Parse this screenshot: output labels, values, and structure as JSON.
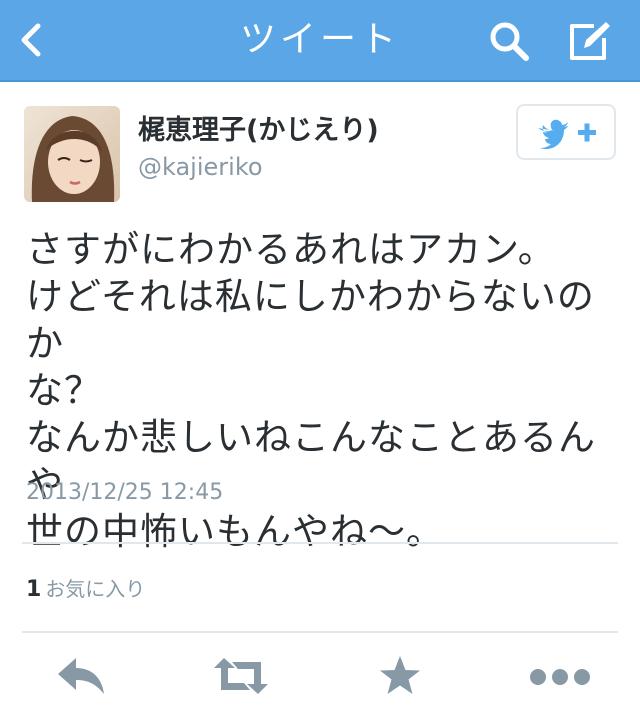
{
  "nav": {
    "title": "ツイート",
    "back_icon": "chevron-left-icon",
    "search_icon": "search-icon",
    "compose_icon": "compose-icon",
    "background": "#5aa6e6"
  },
  "user": {
    "display_name": "梶恵理子(かじえり)",
    "handle": "@kajieriko",
    "follow_icon": "follow-bird-plus-icon"
  },
  "tweet": {
    "text": "さすがにわかるあれはアカン。\nけどそれは私にしかわからないのか\nな？\nなんか悲しいねこんなことあるんや\n世の中怖いもんやね〜。",
    "timestamp": "2013/12/25 12:45",
    "favorites_count": "1",
    "favorites_label": "お気に入り"
  },
  "actions": {
    "reply_icon": "reply-icon",
    "retweet_icon": "retweet-icon",
    "favorite_icon": "star-icon",
    "more_icon": "more-icon",
    "icon_color": "#8899a6"
  }
}
